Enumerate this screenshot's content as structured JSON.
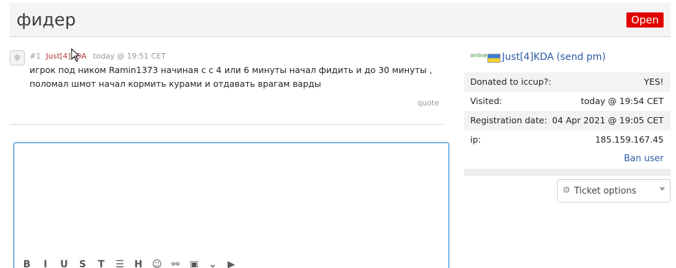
{
  "header": {
    "title": "фидер",
    "status": "Open"
  },
  "post": {
    "number": "#1",
    "author": "Just[4]KDA",
    "time": "today @ 19:51 CET",
    "body": "игрок под ником Ramin1373 начиная с с 4 или 6 минуты начал фидить и до 30 минуты , поломал шмот начал кормить курами и отдавать врагам варды",
    "quote_label": "quote"
  },
  "editor": {
    "toolbar": [
      {
        "name": "bold-icon",
        "glyph": "B"
      },
      {
        "name": "italic-icon",
        "glyph": "I"
      },
      {
        "name": "underline-icon",
        "glyph": "U"
      },
      {
        "name": "strikethrough-icon",
        "glyph": "S"
      },
      {
        "name": "overline-icon",
        "glyph": "T"
      },
      {
        "name": "list-icon",
        "glyph": "☰"
      },
      {
        "name": "heading-icon",
        "glyph": "H"
      },
      {
        "name": "emoji-icon",
        "glyph": "☺"
      },
      {
        "name": "link-icon",
        "glyph": "⚯"
      },
      {
        "name": "image-icon",
        "glyph": "▣"
      },
      {
        "name": "more-icon",
        "glyph": "⌄"
      },
      {
        "name": "video-icon",
        "glyph": "▶"
      }
    ]
  },
  "sidebar": {
    "online_label": "online",
    "flag_icon": "ukraine-flag-icon",
    "user_name": "Just[4]KDA",
    "send_pm": "(send pm)",
    "info": [
      {
        "label": "Donated to iccup?:",
        "value": "YES!"
      },
      {
        "label": "Visited:",
        "value": "today @ 19:54 CET"
      },
      {
        "label": "Registration date:",
        "value": "04 Apr 2021 @ 19:05 CET"
      },
      {
        "label": "ip:",
        "value": "185.159.167.45"
      }
    ],
    "ban_user": "Ban user",
    "ticket_options": "Ticket options"
  },
  "colors": {
    "status": "#e00000",
    "link": "#2b5aa8",
    "editor_border": "#7ab6e6"
  }
}
